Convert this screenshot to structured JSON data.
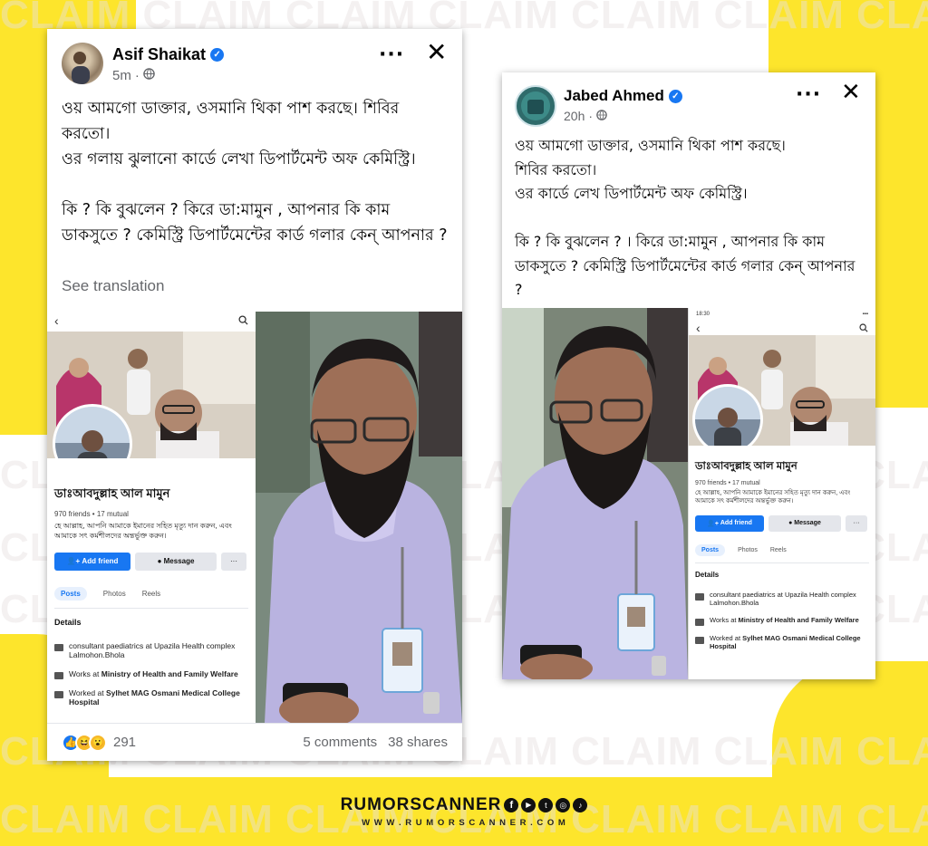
{
  "background": {
    "accent_color": "#fde52c",
    "watermark_text": "CLAIM CLAIM CLAIM CLAIM CLAIM CLAIM CLAIM"
  },
  "left_post": {
    "author": "Asif Shaikat",
    "time": "5m",
    "privacy_icon": "globe-icon",
    "text": "ওয় আমগো ডাক্তার, ওসমানি থিকা পাশ করছে।  শিবির করতো।\nওর গলায় ঝুলানো কার্ডে লেখা ডিপার্টমেন্ট অফ কেমিস্ট্রি।\n\nকি ?  কি বুঝলেন ? কিরে ডা:মামুন , আপনার কি কাম ডাকসুতে ? কেমিস্ট্রি ডিপার্টমেন্টের কার্ড গলার কেন্ আপনার ?",
    "see_translation": "See translation",
    "reaction_count": "291",
    "comments": "5 comments",
    "shares": "38 shares"
  },
  "right_post": {
    "author": "Jabed Ahmed",
    "time": "20h",
    "privacy_icon": "globe-icon",
    "text": "ওয় আমগো ডাক্তার, ওসমানি থিকা পাশ করছে।\nশিবির করতো।\nওর কার্ডে লেখ ডিপার্টমেন্ট অফ কেমিস্ট্রি।\n\nকি ?  কি বুঝলেন ? । কিরে ডা:মামুন , আপনার কি কাম ডাকসুতে ? কেমিস্ট্রি ডিপার্টমেন্টের কার্ড গলার কেন্ আপনার ?",
    "phone_status": "18:30"
  },
  "profile": {
    "name": "ডাঃআবদুল্লাহ আল মামুন",
    "friends": "970 friends • 17 mutual",
    "bio": "হে আল্লাহ, আপনি আমাকে ইমানের সহিত মৃত্যু দান করুন, এবং আমাকে সৎ কর্মশীলদের অন্তর্ভুক্ত করুন।",
    "add_friend": "Add friend",
    "message": "Message",
    "more": "···",
    "tabs": [
      "Posts",
      "Photos",
      "Reels"
    ],
    "details_heading": "Details",
    "details": [
      {
        "pre": "",
        "bold": "",
        "text": "consultant paediatrics at Upazila Health complex Lalmohon.Bhola"
      },
      {
        "pre": "Works at ",
        "bold": "Ministry of Health and Family Welfare",
        "text": ""
      },
      {
        "pre": "Worked at ",
        "bold": "Sylhet MAG Osmani Medical College Hospital",
        "text": ""
      }
    ]
  },
  "brand": {
    "name": "RUMORSCANNER",
    "url": "W W W . R U M O R S C A N N E R . C O M",
    "social_icons": [
      "facebook-icon",
      "youtube-icon",
      "twitter-icon",
      "instagram-icon",
      "tiktok-icon"
    ]
  }
}
